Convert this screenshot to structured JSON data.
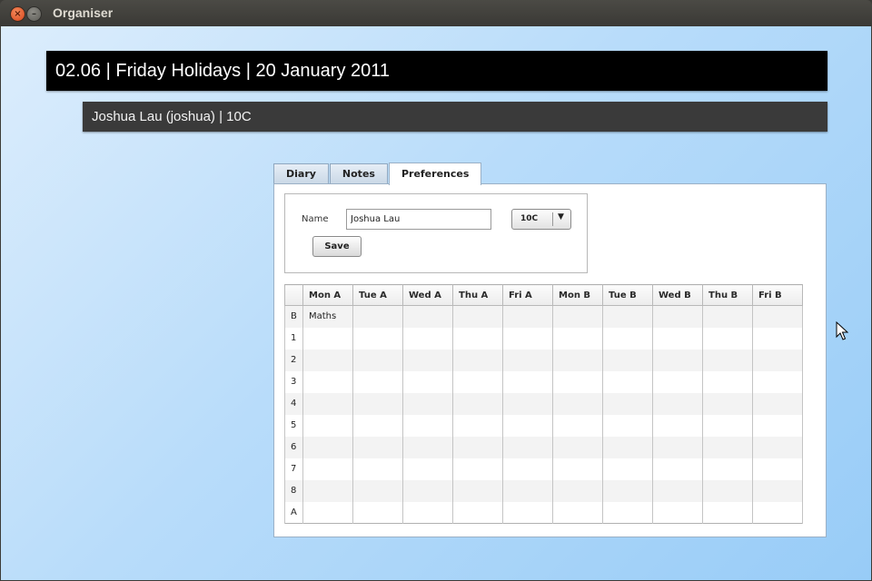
{
  "window": {
    "title": "Organiser"
  },
  "header": {
    "title": "02.06 | Friday Holidays | 20 January 2011"
  },
  "user": {
    "info": "Joshua Lau (joshua) | 10C"
  },
  "tabs": [
    {
      "label": "Diary"
    },
    {
      "label": "Notes"
    },
    {
      "label": "Preferences"
    }
  ],
  "form": {
    "name_label": "Name",
    "name_value": "Joshua Lau",
    "class_value": "10C",
    "save_label": "Save"
  },
  "timetable": {
    "columns": [
      "Mon A",
      "Tue A",
      "Wed A",
      "Thu A",
      "Fri A",
      "Mon B",
      "Tue B",
      "Wed B",
      "Thu B",
      "Fri B"
    ],
    "rows": [
      {
        "label": "B",
        "cells": [
          "Maths",
          "",
          "",
          "",
          "",
          "",
          "",
          "",
          "",
          ""
        ]
      },
      {
        "label": "1",
        "cells": [
          "",
          "",
          "",
          "",
          "",
          "",
          "",
          "",
          "",
          ""
        ]
      },
      {
        "label": "2",
        "cells": [
          "",
          "",
          "",
          "",
          "",
          "",
          "",
          "",
          "",
          ""
        ]
      },
      {
        "label": "3",
        "cells": [
          "",
          "",
          "",
          "",
          "",
          "",
          "",
          "",
          "",
          ""
        ]
      },
      {
        "label": "4",
        "cells": [
          "",
          "",
          "",
          "",
          "",
          "",
          "",
          "",
          "",
          ""
        ]
      },
      {
        "label": "5",
        "cells": [
          "",
          "",
          "",
          "",
          "",
          "",
          "",
          "",
          "",
          ""
        ]
      },
      {
        "label": "6",
        "cells": [
          "",
          "",
          "",
          "",
          "",
          "",
          "",
          "",
          "",
          ""
        ]
      },
      {
        "label": "7",
        "cells": [
          "",
          "",
          "",
          "",
          "",
          "",
          "",
          "",
          "",
          ""
        ]
      },
      {
        "label": "8",
        "cells": [
          "",
          "",
          "",
          "",
          "",
          "",
          "",
          "",
          "",
          ""
        ]
      },
      {
        "label": "A",
        "cells": [
          "",
          "",
          "",
          "",
          "",
          "",
          "",
          "",
          "",
          ""
        ]
      }
    ]
  }
}
